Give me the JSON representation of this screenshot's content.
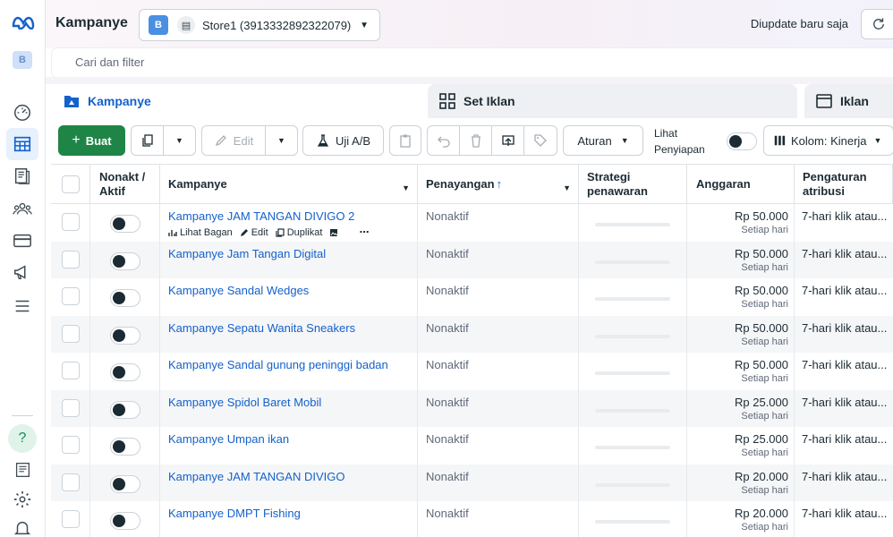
{
  "app": {
    "page_title": "Kampanye",
    "account_badge": "B",
    "account_name": "Store1 (3913332892322079)",
    "updated_text": "Diupdate baru saja",
    "search_placeholder": "Cari dan filter"
  },
  "tabs": [
    {
      "label": "Kampanye",
      "active": true
    },
    {
      "label": "Set Iklan",
      "active": false
    },
    {
      "label": "Iklan",
      "active": false
    }
  ],
  "toolbar": {
    "create_label": "Buat",
    "edit_label": "Edit",
    "ab_test_label": "Uji A/B",
    "rules_label": "Aturan",
    "preview_label_1": "Lihat",
    "preview_label_2": "Penyiapan",
    "columns_label": "Kolom: Kinerja"
  },
  "table": {
    "headers": {
      "toggle": "Nonakt / Aktif",
      "campaign": "Kampanye",
      "delivery": "Penayangan",
      "bid_strategy": "Strategi penawaran",
      "budget": "Anggaran",
      "attribution": "Pengaturan atribusi"
    },
    "row_actions": {
      "view_chart": "Lihat Bagan",
      "edit": "Edit",
      "duplicate": "Duplikat"
    },
    "rows": [
      {
        "name": "Kampanye JAM TANGAN DIVIGO 2",
        "delivery": "Nonaktif",
        "budget": "Rp 50.000",
        "budget_period": "Setiap hari",
        "attribution": "7-hari klik atau..."
      },
      {
        "name": "Kampanye Jam Tangan Digital",
        "delivery": "Nonaktif",
        "budget": "Rp 50.000",
        "budget_period": "Setiap hari",
        "attribution": "7-hari klik atau..."
      },
      {
        "name": "Kampanye Sandal Wedges",
        "delivery": "Nonaktif",
        "budget": "Rp 50.000",
        "budget_period": "Setiap hari",
        "attribution": "7-hari klik atau..."
      },
      {
        "name": "Kampanye Sepatu Wanita Sneakers",
        "delivery": "Nonaktif",
        "budget": "Rp 50.000",
        "budget_period": "Setiap hari",
        "attribution": "7-hari klik atau..."
      },
      {
        "name": "Kampanye Sandal gunung peninggi badan",
        "delivery": "Nonaktif",
        "budget": "Rp 50.000",
        "budget_period": "Setiap hari",
        "attribution": "7-hari klik atau..."
      },
      {
        "name": "Kampanye Spidol Baret Mobil",
        "delivery": "Nonaktif",
        "budget": "Rp 25.000",
        "budget_period": "Setiap hari",
        "attribution": "7-hari klik atau..."
      },
      {
        "name": "Kampanye Umpan ikan",
        "delivery": "Nonaktif",
        "budget": "Rp 25.000",
        "budget_period": "Setiap hari",
        "attribution": "7-hari klik atau..."
      },
      {
        "name": "Kampanye JAM TANGAN DIVIGO",
        "delivery": "Nonaktif",
        "budget": "Rp 20.000",
        "budget_period": "Setiap hari",
        "attribution": "7-hari klik atau..."
      },
      {
        "name": "Kampanye DMPT Fishing",
        "delivery": "Nonaktif",
        "budget": "Rp 20.000",
        "budget_period": "Setiap hari",
        "attribution": "7-hari klik atau..."
      }
    ]
  },
  "colors": {
    "accent": "#1461cc",
    "primary_button": "#1f8547"
  }
}
